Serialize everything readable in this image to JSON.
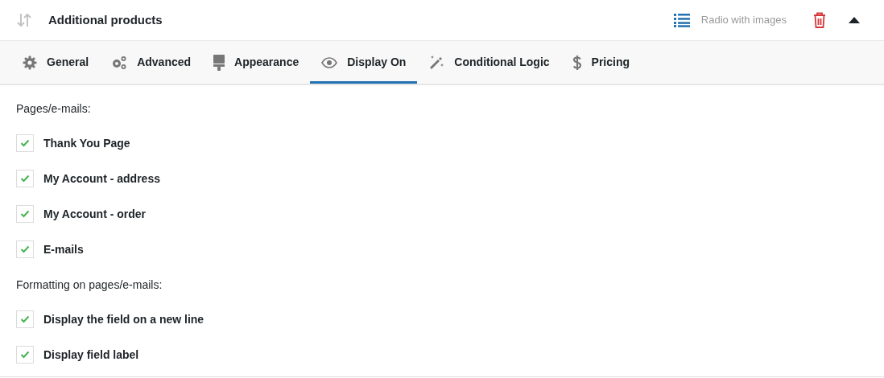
{
  "header": {
    "title": "Additional products",
    "field_type": "Radio with images",
    "expanded": true
  },
  "tabs": [
    {
      "label": "General",
      "selected": false
    },
    {
      "label": "Advanced",
      "selected": false
    },
    {
      "label": "Appearance",
      "selected": false
    },
    {
      "label": "Display On",
      "selected": true
    },
    {
      "label": "Conditional Logic",
      "selected": false
    },
    {
      "label": "Pricing",
      "selected": false
    }
  ],
  "sections": [
    {
      "heading": "Pages/e-mails:",
      "options": [
        {
          "label": "Thank You Page",
          "checked": true
        },
        {
          "label": "My Account - address",
          "checked": true
        },
        {
          "label": "My Account - order",
          "checked": true
        },
        {
          "label": "E-mails",
          "checked": true
        }
      ]
    },
    {
      "heading": "Formatting on pages/e-mails:",
      "options": [
        {
          "label": "Display the field on a new line",
          "checked": true
        },
        {
          "label": "Display field label",
          "checked": true
        }
      ]
    }
  ]
}
